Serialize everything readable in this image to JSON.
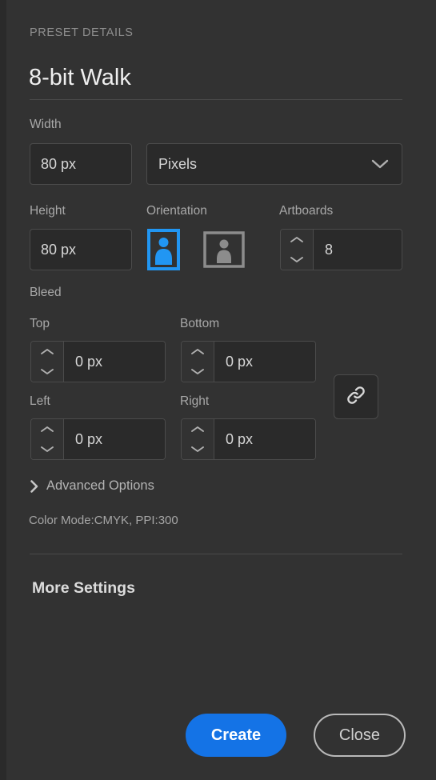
{
  "panel": {
    "section_title": "PRESET DETAILS",
    "preset_name": "8-bit Walk"
  },
  "width_row": {
    "label": "Width",
    "value": "80 px",
    "units_value": "Pixels",
    "units_icon": "chevron-down-icon"
  },
  "height_row": {
    "label": "Height",
    "value": "80 px"
  },
  "orientation": {
    "label": "Orientation",
    "portrait_icon": "portrait-orientation-icon",
    "landscape_icon": "landscape-orientation-icon",
    "selected": "portrait",
    "selected_color": "#2196f3",
    "unselected_color": "#8c8c8c"
  },
  "artboards": {
    "label": "Artboards",
    "value": "8",
    "up_icon": "chevron-up-icon",
    "down_icon": "chevron-down-icon"
  },
  "bleed": {
    "label": "Bleed",
    "link_icon": "link-chain-icon",
    "fields": [
      {
        "label": "Top",
        "value": "0 px"
      },
      {
        "label": "Bottom",
        "value": "0 px"
      },
      {
        "label": "Left",
        "value": "0 px"
      },
      {
        "label": "Right",
        "value": "0 px"
      }
    ]
  },
  "advanced": {
    "label": "Advanced Options",
    "chevron_icon": "chevron-right-icon",
    "summary": "Color Mode:CMYK, PPI:300"
  },
  "more_settings": {
    "label": "More Settings"
  },
  "footer": {
    "create_label": "Create",
    "close_label": "Close",
    "create_color": "#1473e6"
  }
}
